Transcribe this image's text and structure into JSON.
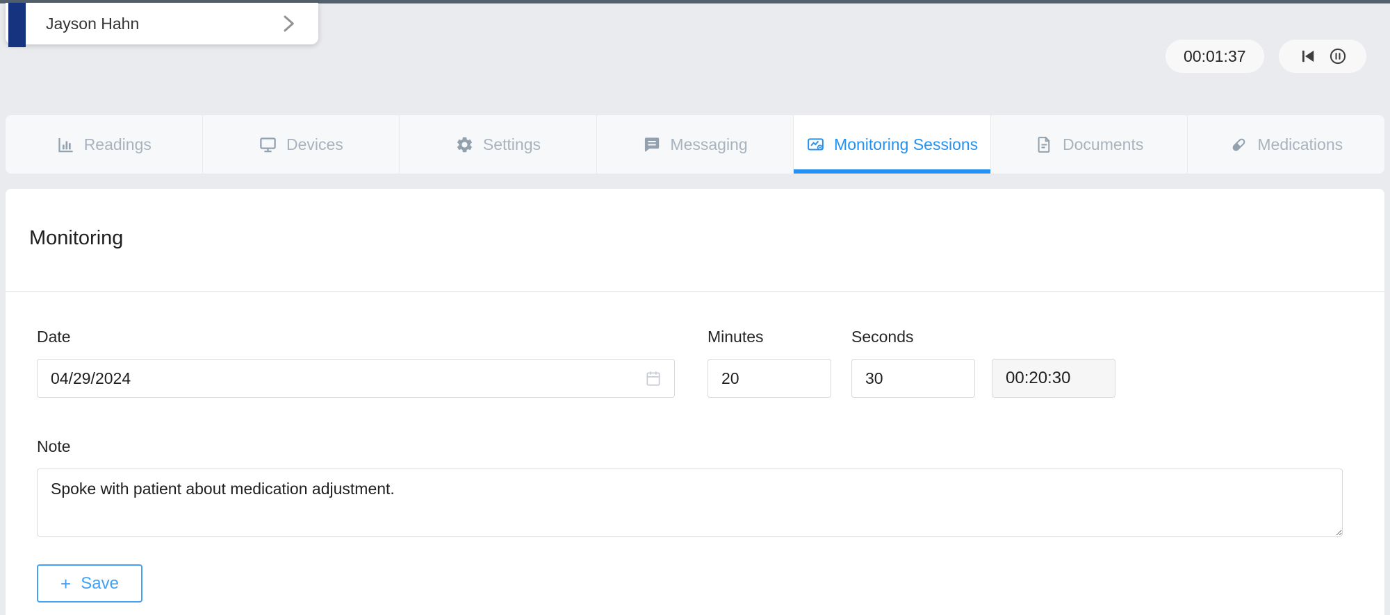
{
  "patient": {
    "name": "Jayson Hahn"
  },
  "timer": {
    "elapsed": "00:01:37"
  },
  "tabs": [
    {
      "label": "Readings",
      "icon": "bar-chart-icon",
      "active": false
    },
    {
      "label": "Devices",
      "icon": "monitor-icon",
      "active": false
    },
    {
      "label": "Settings",
      "icon": "gear-icon",
      "active": false
    },
    {
      "label": "Messaging",
      "icon": "message-icon",
      "active": false
    },
    {
      "label": "Monitoring Sessions",
      "icon": "monitoring-icon",
      "active": true
    },
    {
      "label": "Documents",
      "icon": "document-icon",
      "active": false
    },
    {
      "label": "Medications",
      "icon": "pill-icon",
      "active": false
    }
  ],
  "main": {
    "title": "Monitoring",
    "form": {
      "date": {
        "label": "Date",
        "value": "04/29/2024"
      },
      "minutes": {
        "label": "Minutes",
        "value": "20"
      },
      "seconds": {
        "label": "Seconds",
        "value": "30"
      },
      "duration_display": "00:20:30",
      "note": {
        "label": "Note",
        "value": "Spoke with patient about medication adjustment."
      },
      "save": {
        "plus": "+",
        "label": "Save"
      }
    }
  },
  "colors": {
    "accent_blue": "#2591f0",
    "save_blue": "#42a1f5",
    "navy_bar": "#15337f",
    "top_strip": "#52616c",
    "page_background": "#eaebee",
    "tab_inactive_text": "#a8b3be"
  }
}
